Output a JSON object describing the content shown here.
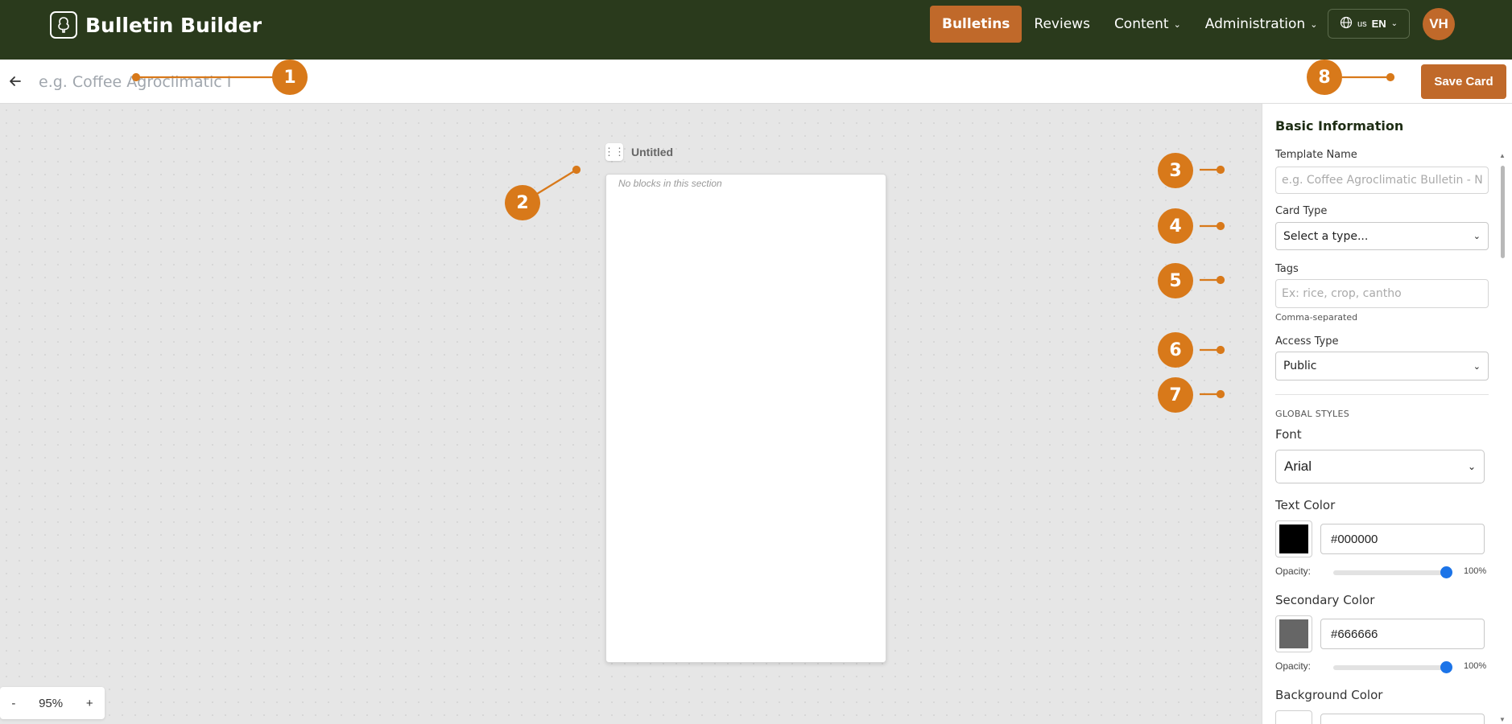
{
  "header": {
    "brand": "Bulletin Builder",
    "nav": [
      {
        "label": "Bulletins",
        "active": true
      },
      {
        "label": "Reviews",
        "has_dropdown": false
      },
      {
        "label": "Content",
        "has_dropdown": true
      },
      {
        "label": "Administration",
        "has_dropdown": true
      }
    ],
    "language": {
      "flag": "us",
      "code": "EN"
    },
    "avatar": "VH"
  },
  "subheader": {
    "title_placeholder": "e.g. Coffee Agroclimatic I",
    "save_label": "Save Card"
  },
  "canvas": {
    "section_title": "Untitled",
    "empty_message": "No blocks in this section",
    "zoom": {
      "minus": "-",
      "value": "95%",
      "plus": "+"
    }
  },
  "panel": {
    "title": "Basic Information",
    "template_name": {
      "label": "Template Name",
      "placeholder": "e.g. Coffee Agroclimatic Bulletin - No"
    },
    "card_type": {
      "label": "Card Type",
      "value": "Select a type..."
    },
    "tags": {
      "label": "Tags",
      "placeholder": "Ex: rice, crop, cantho",
      "help": "Comma-separated"
    },
    "access_type": {
      "label": "Access Type",
      "value": "Public"
    },
    "global_styles": "GLOBAL STYLES",
    "font": {
      "label": "Font",
      "value": "Arial"
    },
    "text_color": {
      "label": "Text Color",
      "hex": "#000000",
      "opacity_label": "Opacity:",
      "opacity": "100%"
    },
    "secondary_color": {
      "label": "Secondary Color",
      "hex": "#666666",
      "opacity_label": "Opacity:",
      "opacity": "100%"
    },
    "background_color": {
      "label": "Background Color"
    }
  },
  "callouts": [
    "1",
    "2",
    "3",
    "4",
    "5",
    "6",
    "7",
    "8"
  ],
  "colors": {
    "nav_bg": "#2a3a1c",
    "accent": "#c0692a",
    "callout": "#d8791a",
    "slider": "#1c74e8"
  }
}
